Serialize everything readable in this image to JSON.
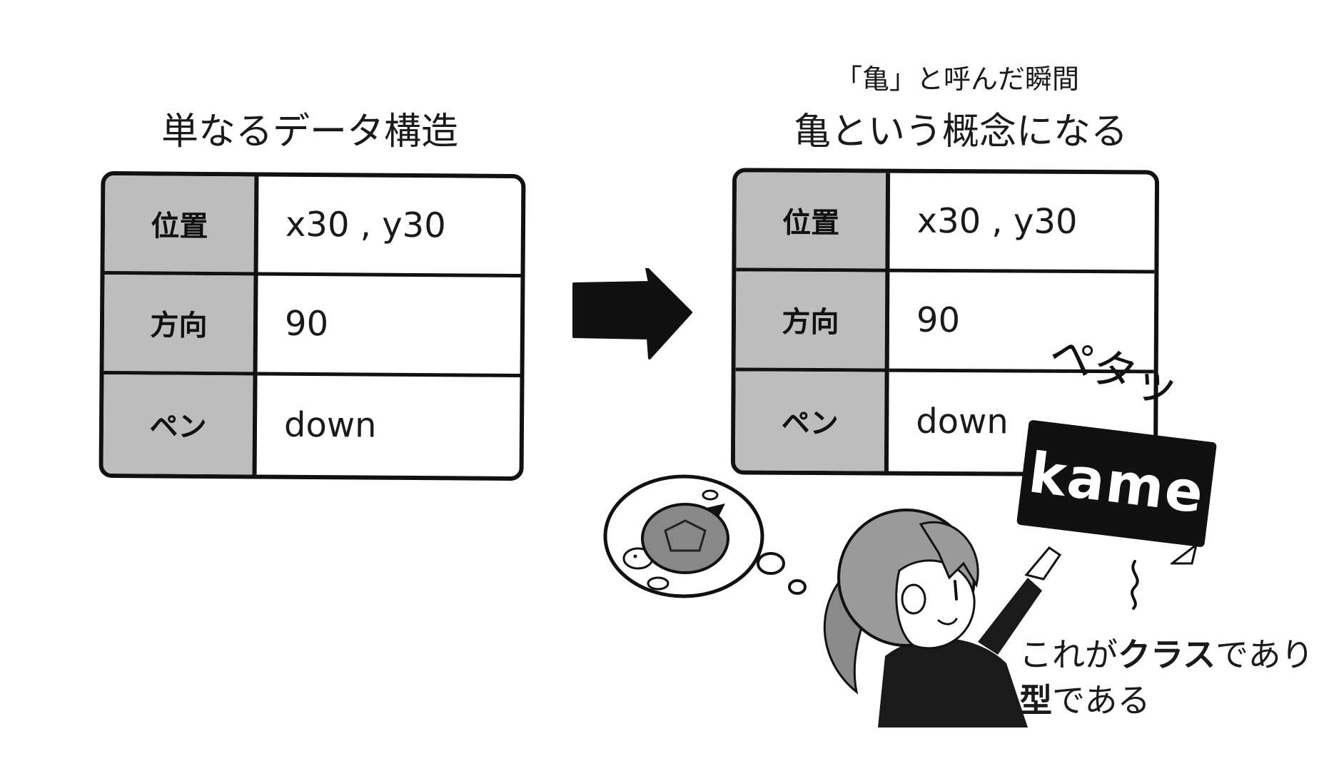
{
  "left": {
    "title": "単なるデータ構造",
    "rows": [
      {
        "label": "位置",
        "value": "x30 , y30"
      },
      {
        "label": "方向",
        "value": "90"
      },
      {
        "label": "ペン",
        "value": "down"
      }
    ]
  },
  "right": {
    "subtitle": "「亀」と呼んだ瞬間",
    "title": "亀という概念になる",
    "rows": [
      {
        "label": "位置",
        "value": "x30 , y30"
      },
      {
        "label": "方向",
        "value": "90"
      },
      {
        "label": "ペン",
        "value": "down"
      }
    ]
  },
  "sign": {
    "text": "kame",
    "sfx": "ペタッ"
  },
  "caption": {
    "line1_a": "これが",
    "line1_b": "クラス",
    "line1_c": "であり",
    "line2_a": "型",
    "line2_b": "である"
  },
  "icons": [
    "arrow-right-icon",
    "turtle-icon",
    "thought-bubble-icon",
    "girl-illustration"
  ]
}
